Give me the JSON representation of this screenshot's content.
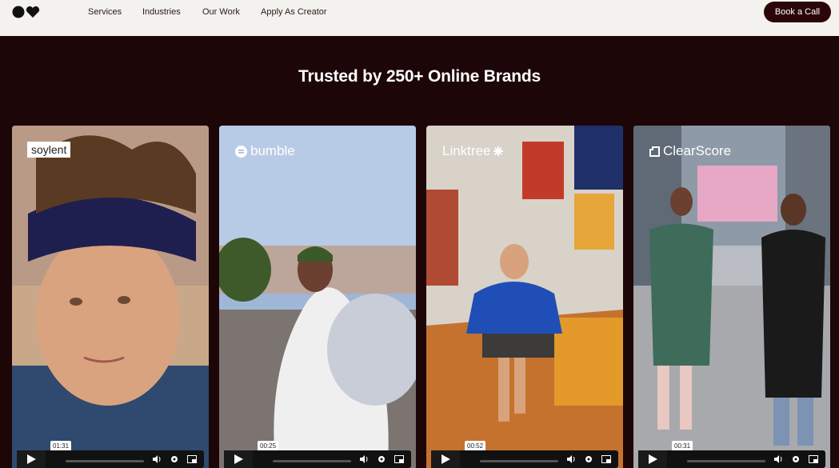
{
  "nav": {
    "links": [
      "Services",
      "Industries",
      "Our Work",
      "Apply As Creator"
    ],
    "cta": "Book a Call"
  },
  "heading": "Trusted by 250+ Online Brands",
  "cards": [
    {
      "brand": "soylent",
      "time": "01:31"
    },
    {
      "brand": "bumble",
      "time": "00:25"
    },
    {
      "brand": "Linktree",
      "time": "00:52"
    },
    {
      "brand": "ClearScore",
      "time": "00:31"
    }
  ],
  "colors": {
    "background": "#1d0608",
    "nav_bg": "#f4f2ee",
    "cta_bg": "#2b0607",
    "text_light": "#ffffff"
  },
  "icons": [
    "logo-circle-heart-icon",
    "play-icon",
    "volume-icon",
    "settings-icon",
    "picture-in-picture-icon",
    "bumble-logo-icon",
    "linktree-asterisk-icon",
    "clearscore-logo-icon"
  ]
}
